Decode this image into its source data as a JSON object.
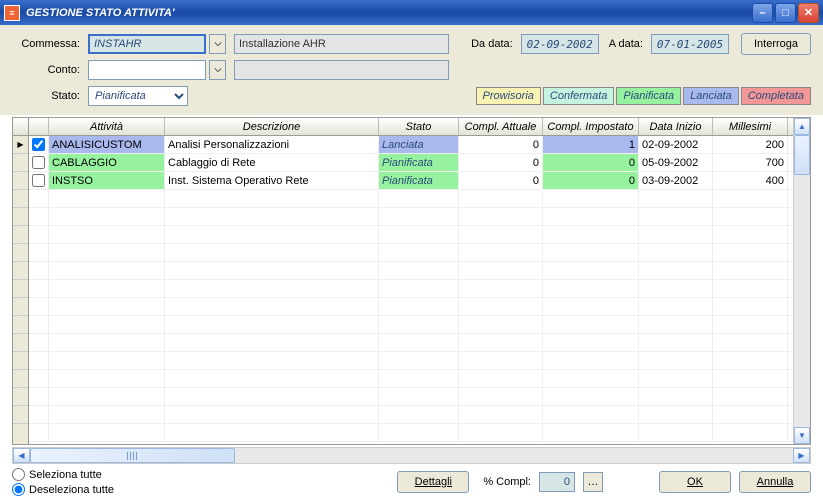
{
  "title": "GESTIONE STATO ATTIVITA'",
  "labels": {
    "commessa": "Commessa:",
    "conto": "Conto:",
    "stato": "Stato:",
    "da_data": "Da data:",
    "a_data": "A data:",
    "interroga": "Interroga",
    "dettagli": "Dettagli",
    "percent_compl": "% Compl:",
    "ok": "OK",
    "annulla": "Annulla",
    "seleziona": "Seleziona tutte",
    "deseleziona": "Deseleziona tutte"
  },
  "inputs": {
    "commessa_code": "INSTAHR",
    "commessa_desc": "Installazione AHR",
    "conto_code": "",
    "conto_desc": "",
    "stato_sel": "Pianificata",
    "da_data": "02-09-2002",
    "a_data": "07-01-2005",
    "percent_compl": "0"
  },
  "legend": {
    "prov": "Prowisoria",
    "conf": "Confermata",
    "pian": "Pianificata",
    "lanc": "Lanciata",
    "comp": "Completata"
  },
  "columns": {
    "attivita": "Attività",
    "descrizione": "Descrizione",
    "stato": "Stato",
    "compl_attuale": "Compl. Attuale",
    "compl_impostato": "Compl. Impostato",
    "data_inizio": "Data Inizio",
    "millesimi": "Millesimi"
  },
  "rows": [
    {
      "checked": true,
      "attivita": "ANALISICUSTOM",
      "descrizione": "Analisi Personalizzazioni",
      "stato": "Lanciata",
      "stato_class": "lanc",
      "compl_att": "0",
      "compl_imp": "1",
      "data_inizio": "02-09-2002",
      "millesimi": "200"
    },
    {
      "checked": false,
      "attivita": "CABLAGGIO",
      "descrizione": "Cablaggio di Rete",
      "stato": "Pianificata",
      "stato_class": "pian",
      "compl_att": "0",
      "compl_imp": "0",
      "data_inizio": "05-09-2002",
      "millesimi": "700"
    },
    {
      "checked": false,
      "attivita": "INSTSO",
      "descrizione": "Inst. Sistema Operativo Rete",
      "stato": "Pianificata",
      "stato_class": "pian",
      "compl_att": "0",
      "compl_imp": "0",
      "data_inizio": "03-09-2002",
      "millesimi": "400"
    }
  ],
  "radio_selected": "deseleziona"
}
